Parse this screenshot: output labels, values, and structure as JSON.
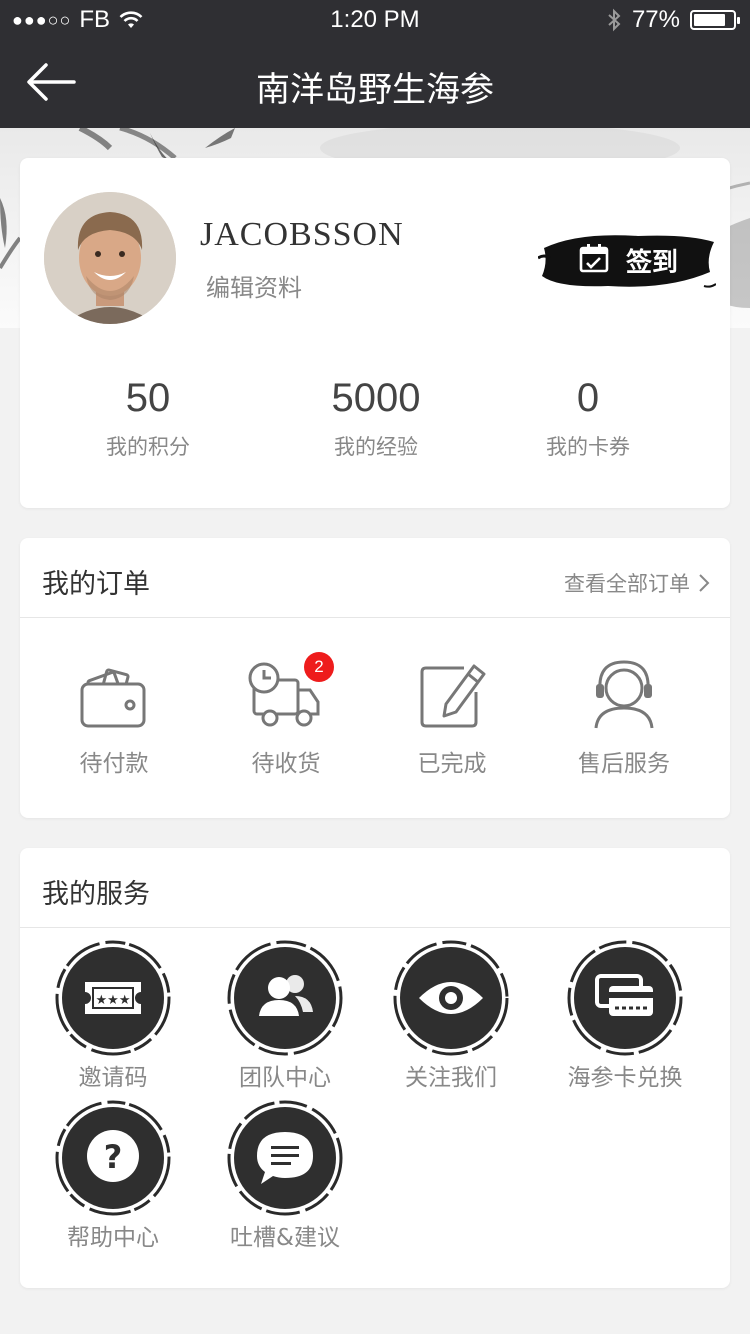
{
  "status_bar": {
    "carrier": "FB",
    "time": "1:20 PM",
    "battery": "77%",
    "battery_level": 0.77
  },
  "nav": {
    "title": "南洋岛野生海参"
  },
  "profile": {
    "username": "JACOBSSON",
    "edit_label": "编辑资料",
    "signin_label": "签到",
    "stats": [
      {
        "value": "50",
        "label": "我的积分"
      },
      {
        "value": "5000",
        "label": "我的经验"
      },
      {
        "value": "0",
        "label": "我的卡券"
      }
    ]
  },
  "orders": {
    "title": "我的订单",
    "view_all": "查看全部订单",
    "items": [
      {
        "label": "待付款",
        "icon": "wallet-icon"
      },
      {
        "label": "待收货",
        "icon": "delivery-truck-icon",
        "badge": "2"
      },
      {
        "label": "已完成",
        "icon": "edit-note-icon"
      },
      {
        "label": "售后服务",
        "icon": "customer-service-icon"
      }
    ]
  },
  "services": {
    "title": "我的服务",
    "items": [
      {
        "label": "邀请码",
        "icon": "ticket-icon"
      },
      {
        "label": "团队中心",
        "icon": "team-icon"
      },
      {
        "label": "关注我们",
        "icon": "eye-icon"
      },
      {
        "label": "海参卡兑换",
        "icon": "cards-icon"
      },
      {
        "label": "帮助中心",
        "icon": "help-icon"
      },
      {
        "label": "吐槽&建议",
        "icon": "chat-icon"
      }
    ]
  },
  "colors": {
    "nav_bg": "#2f2f33",
    "badge": "#ee1c1c",
    "text_primary": "#333333",
    "text_secondary": "#888888"
  }
}
